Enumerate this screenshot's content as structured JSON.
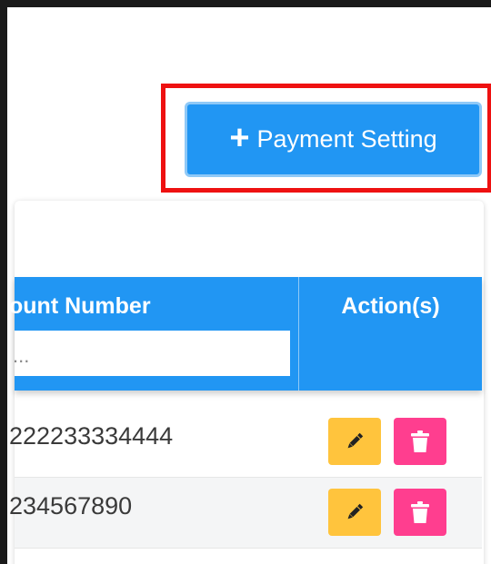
{
  "toolbar": {
    "add_button_label": "Payment Setting",
    "add_button_icon": "plus-icon"
  },
  "table": {
    "columns": [
      {
        "label": "ount Number",
        "filter_placeholder": "..."
      },
      {
        "label": "Action(s)"
      }
    ],
    "rows": [
      {
        "account_number": "222233334444"
      },
      {
        "account_number": "234567890"
      }
    ]
  },
  "colors": {
    "primary": "#2196f3",
    "edit": "#ffc43d",
    "delete": "#ff3e8f",
    "highlight": "#ee1111"
  },
  "icons": {
    "edit": "pencil-icon",
    "delete": "trash-icon"
  }
}
